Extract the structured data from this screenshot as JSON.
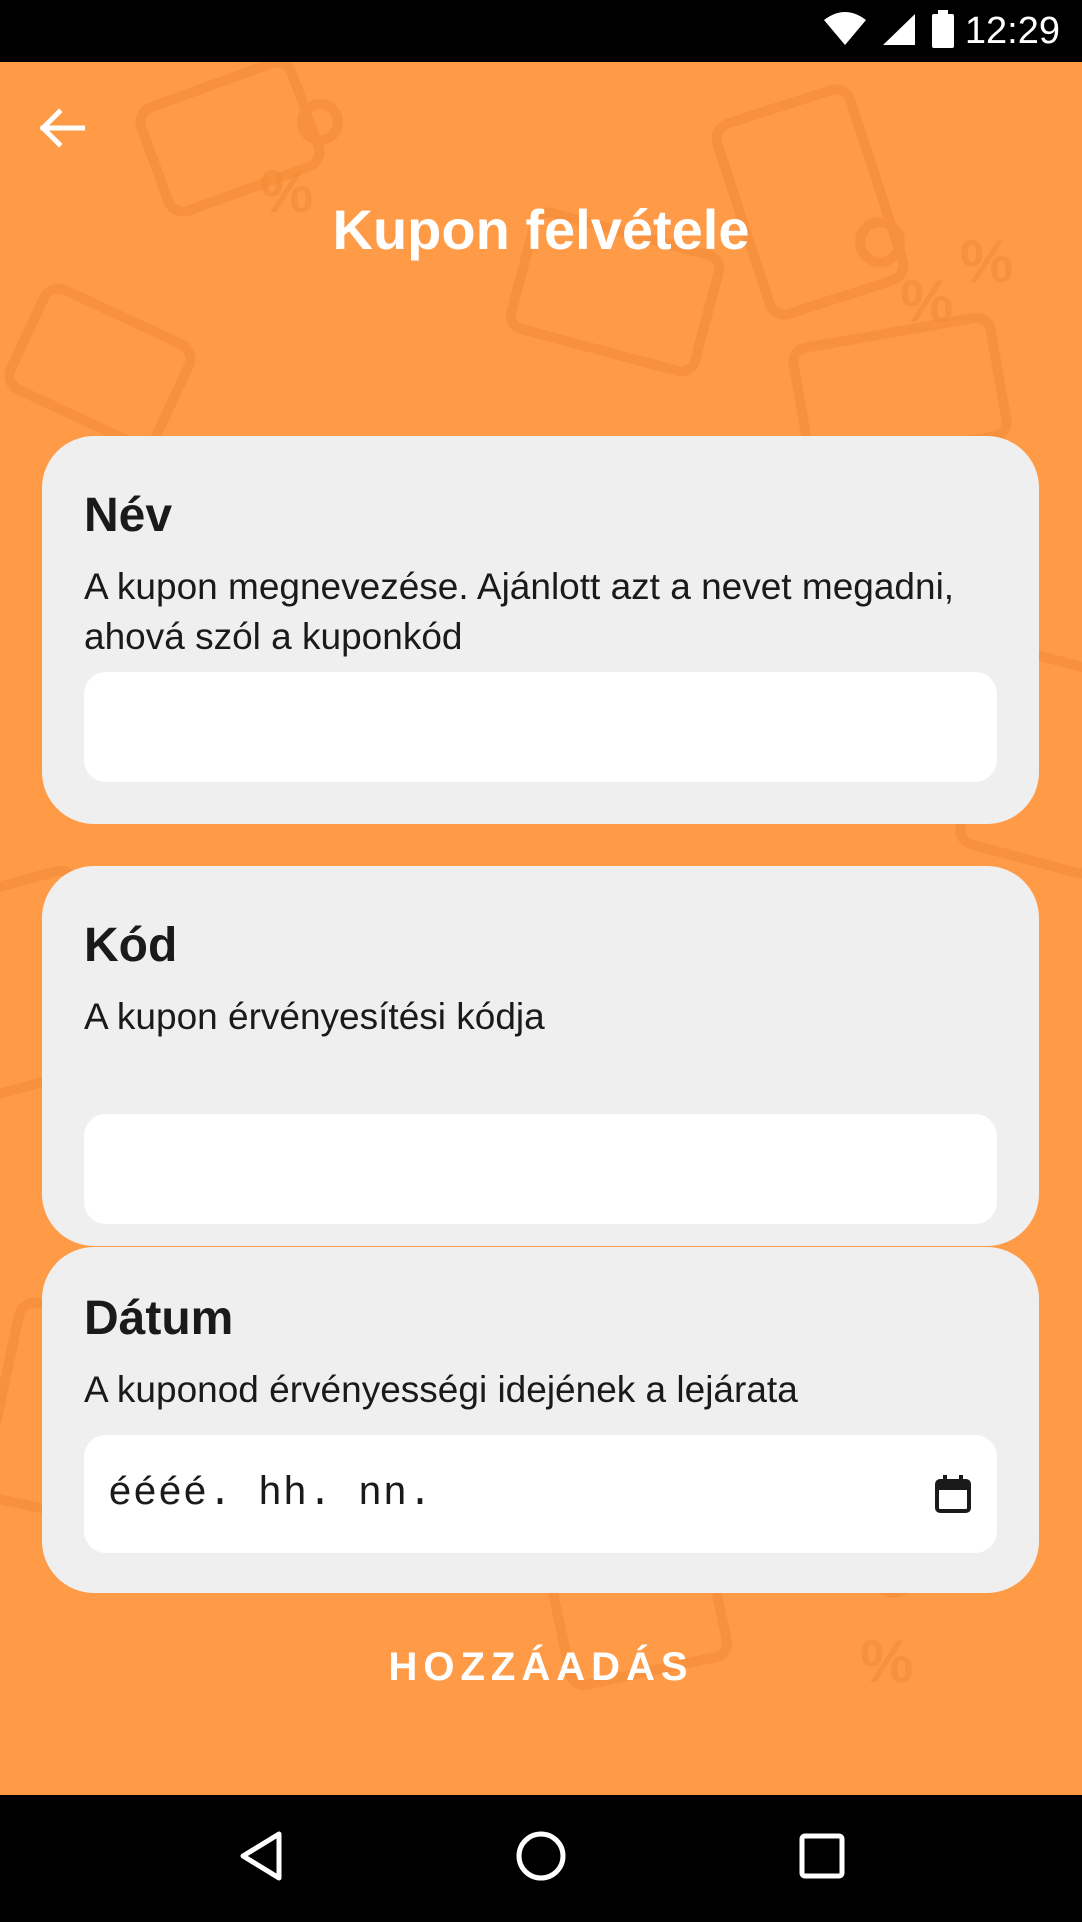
{
  "status_bar": {
    "time": "12:29",
    "icons": [
      "wifi-icon",
      "signal-icon",
      "battery-icon"
    ]
  },
  "header": {
    "back_icon": "arrow-left-icon",
    "title": "Kupon felvétele"
  },
  "form": {
    "name": {
      "label": "Név",
      "description": "A kupon megnevezése. Ajánlott azt a nevet megadni, ahová szól a kuponkód",
      "value": ""
    },
    "code": {
      "label": "Kód",
      "description": "A kupon érvényesítési kódja",
      "value": ""
    },
    "date": {
      "label": "Dátum",
      "description": "A kuponod érvényességi idejének a lejárata",
      "placeholder": "éééé. hh. nn.",
      "icon": "calendar-icon"
    }
  },
  "actions": {
    "submit_label": "HOZZÁADÁS"
  },
  "nav_bar": {
    "icons": [
      "back-triangle-icon",
      "home-circle-icon",
      "recents-square-icon"
    ]
  },
  "colors": {
    "background": "#ff9a47",
    "card": "#efefef",
    "input": "#ffffff",
    "text": "#1a1a1a"
  }
}
